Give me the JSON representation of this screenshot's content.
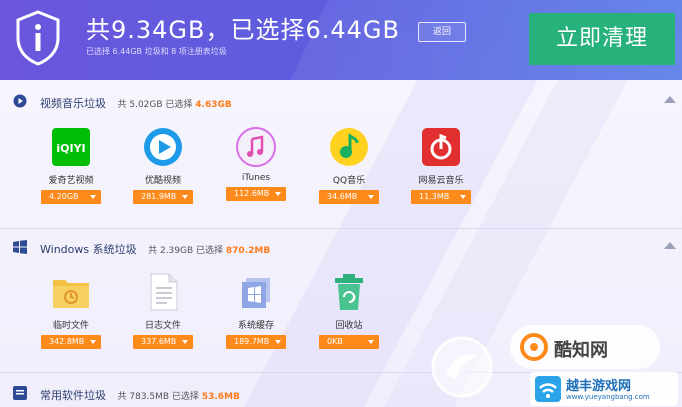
{
  "header": {
    "title": "共9.34GB，已选择6.44GB",
    "subtitle": "已选择 6.44GB 垃圾和 8 项注册表垃圾",
    "back_label": "返回",
    "clean_label": "立即清理"
  },
  "sections": [
    {
      "title": "视频音乐垃圾",
      "stat": "共 5.02GB 已选择",
      "selected": "4.63GB",
      "apps": [
        {
          "label": "爱奇艺视频",
          "size": "4.20GB"
        },
        {
          "label": "优酷视频",
          "size": "281.9MB"
        },
        {
          "label": "iTunes",
          "size": "112.6MB"
        },
        {
          "label": "QQ音乐",
          "size": "34.6MB"
        },
        {
          "label": "网易云音乐",
          "size": "11.3MB"
        }
      ]
    },
    {
      "title": "Windows 系统垃圾",
      "stat": "共 2.39GB 已选择",
      "selected": "870.2MB",
      "apps": [
        {
          "label": "临时文件",
          "size": "342.8MB"
        },
        {
          "label": "日志文件",
          "size": "337.6MB"
        },
        {
          "label": "系统缓存",
          "size": "189.7MB"
        },
        {
          "label": "回收站",
          "size": "0KB"
        }
      ]
    },
    {
      "title": "常用软件垃圾",
      "stat": "共 783.5MB 已选择",
      "selected": "53.6MB"
    }
  ],
  "watermark": {
    "brand": "酷知网",
    "brand2": "越丰游戏网",
    "url": "www.yueyangbang.com"
  },
  "colors": {
    "accent_orange": "#ff8a1c",
    "clean_green": "#28b27b",
    "header_purple": "#6a56dc"
  }
}
